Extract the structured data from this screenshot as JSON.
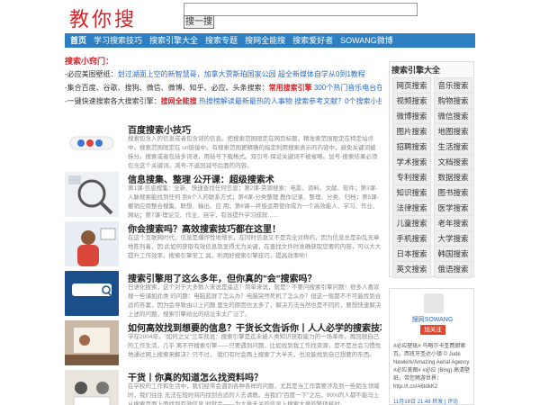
{
  "header": {
    "logo": "教你搜",
    "search_value": "",
    "search_button": "搜一搜"
  },
  "nav": {
    "items": [
      "首页",
      "学习搜索技巧",
      "搜索引擎大全",
      "搜索专题",
      "搜网全能搜",
      "搜索爱好者",
      "SOWANG微博"
    ]
  },
  "tips": {
    "title": "搜索小窍门：",
    "lines": [
      [
        {
          "t": "-必应美图壁纸：",
          "c": "plain"
        },
        {
          "t": "划过湖面上空的新智慧哥，加拿大贾斯珀国家公园",
          "c": "blue"
        },
        {
          "t": "  ",
          "c": "plain"
        },
        {
          "t": "超全新媒体自学从0到1教程",
          "c": "blue"
        }
      ],
      [
        {
          "t": "-集合百度、谷歌、搜狗、微信、微博、知乎、必应、头条搜索：",
          "c": "plain"
        },
        {
          "t": "常用搜索引擎",
          "c": "red"
        },
        {
          "t": "  ",
          "c": "plain"
        },
        {
          "t": "300个热门音乐电台在线收听",
          "c": "blue"
        }
      ],
      [
        {
          "t": "-一键快速搜索各大搜索引擎：",
          "c": "plain"
        },
        {
          "t": "搜网全能搜",
          "c": "red"
        },
        {
          "t": "  ",
          "c": "plain"
        },
        {
          "t": "热搜榜解读最新最热的人事物",
          "c": "blue"
        },
        {
          "t": "  ",
          "c": "plain"
        },
        {
          "t": "搜索参考文献？0个搜索小技巧",
          "c": "blue"
        }
      ]
    ]
  },
  "articles": [
    {
      "title": "百度搜索小技巧",
      "excerpt": "搜索包含入的信息或者包含词的信息。把搜索范围限定在网页标题，精准索范围限定在特定站点中。搜索范围限定在\nurl链接中。有搜索范围更精确的指定利用搜索表示的内容中，避免关键词被拆分。搜索或者包括多词语，用括号下载格式。双引号-保证关键词不被省略。加号-搜索结果必须包含这个关键词。减号-不返回减号后面的内容。"
    },
    {
      "title": "信息搜集、整理 公开课：超级搜索术",
      "excerpt": "第1课-信息搜集：全新、快速查找任何信息；第2课-资源搜索：电影、资料、文献、软件；第3课-人脉搜索能找到任何\n到6个人的联系方式；第4课-分类整理 教你记录、整理、分类、归档；第5课-撤销应用整合搜集、联想、输出、应\n用；第6课—终极运用使你成为一个高效能人、学习、作业、网站；第7课-理论交、作业、自学，有效提升学习成就……"
    },
    {
      "title": "你会搜索吗？高效搜索技巧都在这里！",
      "excerpt": "在这个互联网时代，信息是爆炸性地增长，在同时信息又不是完全对称的，因为信息总是杂乱无章地陈列着，因\n此如何获取有效信息就显得尤为关键，在查找文件时准确获取您要的内容，可以大大提升工作效率。搜索引擎至工\n具，利用好搜索引擎技巧，提高效率哟！"
    },
    {
      "title": "搜索引擎用了这么多年，但你真的\"会\"搜索吗？",
      "excerpt": "日语化搜索，这个对于大多数人来说是遥远！简单来说，就是：不要问搜索引擎问题！很多人喜欢搜一些谴如此类\n的问题：电脑蓝屏了怎么办？电脑突然死机了怎么办？但这一般都不不可能找到合适的答案，因为会导致由以上问题\n里生的原因也太多了，解决方法当然也是不同的，要想快速解决上述的问题，搜索引擎给出的结论未太广泛了。"
    },
    {
      "title": "如何高效找到想要的信息？干货长文告诉你丨人人必学的搜索技巧",
      "excerpt": "学在2004年，\"如何之父\"兰军就说：搜索引擎是迄未被人类知识获取能力的一场革命，再回顾自己的工作生活，几乎\n离不开搜索引擎——只要遇到问题，比如找到我工作找资源，是不是总会习惯性地通过网上搜索来解决？只不过，\n我们有时会两上搜索了大半天，也没能找到自己想要的东西。"
    },
    {
      "title": "干货丨你真的知道怎么找资料吗？",
      "excerpt": "在学校的工作和生活中，我们经常会遇到各种各样的问题，尤其是当工作需要涉及到一些陌生领域时，我们往往\n无法在短时间内找到合适的人去请教。当我们\"百度一下\"之后，90%的人都不能马上从搜索页面上面找到有效信息\n时就会——为大量无关的信息上搜索大量的繁琐耗时。"
    }
  ],
  "sidebar": {
    "title": "搜索引擎大全",
    "categories": [
      "网页搜索",
      "音乐搜索",
      "视频搜索",
      "购物搜索",
      "微博搜索",
      "微信搜索",
      "图片搜索",
      "地图搜索",
      "招聘搜索",
      "生活搜索",
      "学术搜索",
      "文档搜索",
      "专利搜索",
      "数据搜索",
      "知识搜索",
      "图书搜索",
      "法律搜索",
      "医学搜索",
      "儿童搜索",
      "老年搜索",
      "手机搜索",
      "大学搜索",
      "日本搜索",
      "韩国搜索",
      "英文搜索",
      "俄语搜索"
    ]
  },
  "weibo": {
    "name": "搜网SOWANG",
    "follow": "加关注",
    "post": "#必应壁纸# 马略尔卡圣费朗索瓦，西班牙圣达小镇 © Jude Newkirk/Amazing Aerial Agency #必应美图# #必应 (Bing) 高清壁纸，带您畅游世界：http://t.cn/A6tdkK2",
    "meta": "11月18日 21:48   转发 | 评论"
  }
}
